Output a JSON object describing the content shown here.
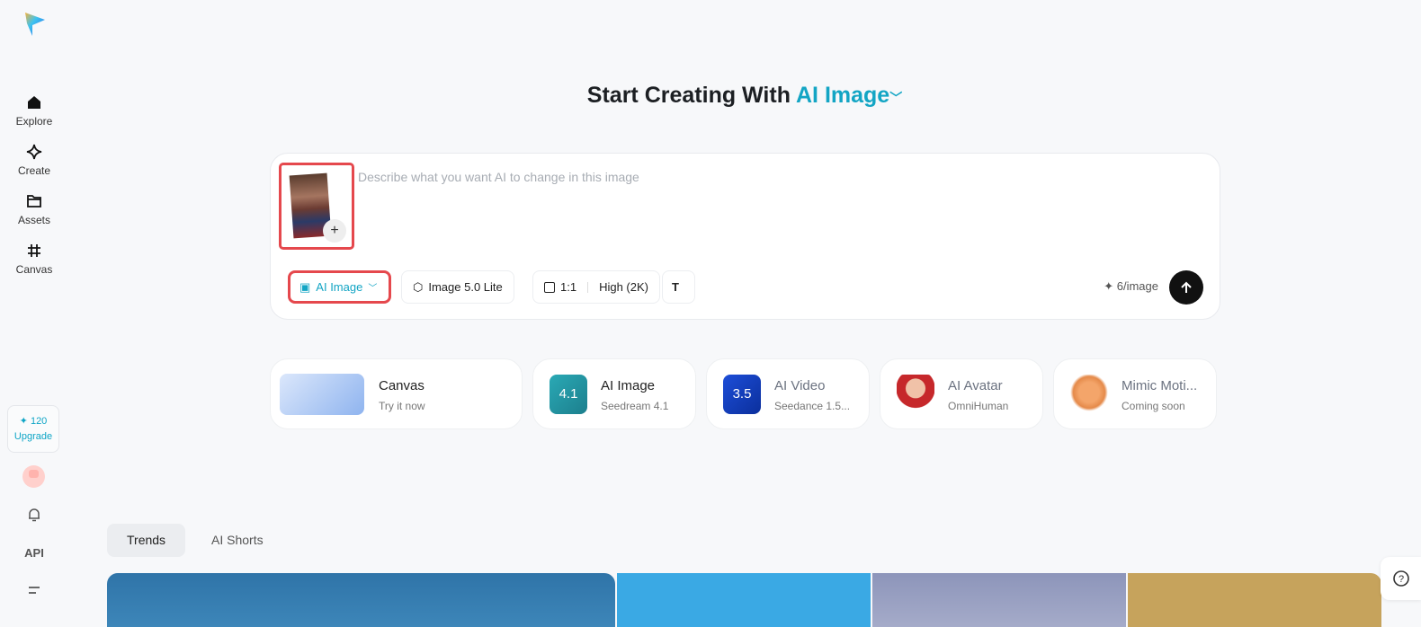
{
  "sidebar": {
    "items": [
      {
        "label": "Explore"
      },
      {
        "label": "Create"
      },
      {
        "label": "Assets"
      },
      {
        "label": "Canvas"
      }
    ],
    "credits": "✦ 120",
    "upgrade": "Upgrade",
    "api": "API"
  },
  "header": {
    "title_prefix": "Start Creating With",
    "title_accent": "AI Image"
  },
  "composer": {
    "placeholder": "Describe what you want AI to change in this image",
    "mode": "AI Image",
    "model": "Image 5.0 Lite",
    "ratio": "1:1",
    "quality": "High (2K)",
    "cost": "6/image"
  },
  "cards": [
    {
      "title": "Canvas",
      "subtitle": "Try it now"
    },
    {
      "title": "AI Image",
      "subtitle": "Seedream 4.1",
      "badge": "4.1"
    },
    {
      "title": "AI Video",
      "subtitle": "Seedance 1.5...",
      "badge": "3.5"
    },
    {
      "title": "AI Avatar",
      "subtitle": "OmniHuman"
    },
    {
      "title": "Mimic Moti...",
      "subtitle": "Coming soon"
    }
  ],
  "tabs": [
    {
      "label": "Trends"
    },
    {
      "label": "AI Shorts"
    }
  ],
  "colors": {
    "accent": "#13a5c4",
    "highlight": "#e5484d"
  }
}
